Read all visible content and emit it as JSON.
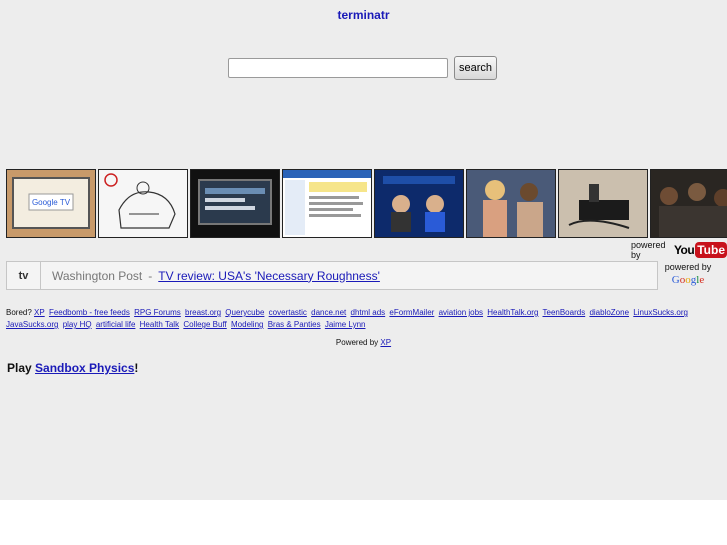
{
  "header": {
    "title": "terminatr"
  },
  "search": {
    "value": "",
    "placeholder": "",
    "button_label": "search"
  },
  "thumbnails": [
    {
      "icon": "google-tv-thumbnail"
    },
    {
      "icon": "cartoon-sketch-thumbnail"
    },
    {
      "icon": "tv-screen-thumbnail"
    },
    {
      "icon": "web-page-thumbnail"
    },
    {
      "icon": "news-weather-thumbnail"
    },
    {
      "icon": "wrestlers-thumbnail"
    },
    {
      "icon": "device-photo-thumbnail"
    },
    {
      "icon": "people-group-thumbnail"
    }
  ],
  "youtube": {
    "powered_by": "powered by",
    "logo_you": "You",
    "logo_tube": "Tube"
  },
  "news": {
    "topic": "tv",
    "source": "Washington Post",
    "separator": "-",
    "headline": "TV review: USA's 'Necessary Roughness'"
  },
  "google": {
    "powered_by": "powered by",
    "logo": [
      "G",
      "o",
      "o",
      "g",
      "l",
      "e"
    ]
  },
  "bored": {
    "label": "Bored?",
    "links": [
      "XP",
      "Feedbomb - free feeds",
      "RPG Forums",
      "breast.org",
      "Querycube",
      "covertastic",
      "dance.net",
      "dhtml ads",
      "eFormMailer",
      "aviation jobs",
      "HealthTalk.org",
      "TeenBoards",
      "diabloZone",
      "LinuxSucks.org",
      "JavaSucks.org",
      "play HQ",
      "artificial life",
      "Health Talk",
      "College Buff",
      "Modeling",
      "Bras & Panties",
      "Jaime Lynn"
    ]
  },
  "footer": {
    "powered_by": "Powered by",
    "link": "XP"
  },
  "play": {
    "prefix": "Play",
    "link": "Sandbox Physics",
    "suffix": "!"
  },
  "colors": {
    "background": "#ededed",
    "link": "#1a1ab8",
    "youtube_red": "#c8121c"
  }
}
